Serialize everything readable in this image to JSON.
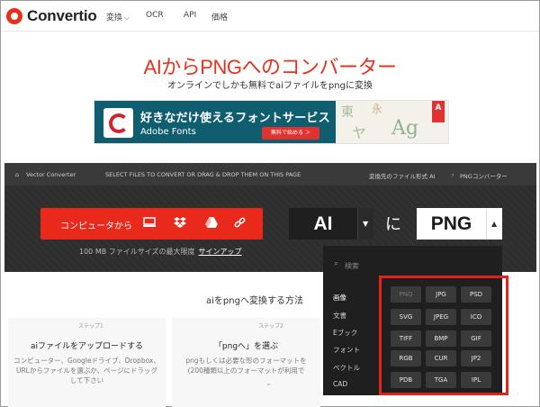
{
  "brand": {
    "name": "Convertio"
  },
  "nav": {
    "convert": "変換",
    "ocr": "OCR",
    "api": "API",
    "pricing": "価格"
  },
  "hero": {
    "title": "AIからPNGへのコンバーター",
    "subtitle": "オンラインでしかも無料でaiファイルをpngに変換"
  },
  "ad": {
    "headline": "好きなだけ使えるフォントサービス",
    "brand": "Adobe Fonts",
    "cta": "無料で始める ＞",
    "adobe_badge": "A"
  },
  "converter": {
    "breadcrumb": "Vector Converter",
    "instruction": "SELECT FILES TO CONVERT OR DRAG & DROP THEM ON THIS PAGE",
    "target_label": "変換先のファイル形式 AI",
    "target_link": "PNGコンバーター",
    "upload_label": "コンピュータから",
    "max_size": "100 MB ファイルサイズの最大限度",
    "signup": "サインアップ",
    "from_format": "AI",
    "connector": "に",
    "to_format": "PNG"
  },
  "dropdown": {
    "search_placeholder": "検索",
    "categories": [
      "画像",
      "文書",
      "Eブック",
      "フォント",
      "ベクトル",
      "CAD"
    ],
    "formats": [
      "PNG",
      "JPG",
      "PSD",
      "SVG",
      "JPEG",
      "ICO",
      "TIFF",
      "BMP",
      "GIF",
      "RGB",
      "CUR",
      "JP2",
      "PDB",
      "TGA",
      "IPL"
    ]
  },
  "howto": {
    "title": "aiをpngへ変換する方法",
    "step1_badge": "ステップ1",
    "step1_title": "aiファイルをアップロードする",
    "step1_desc": [
      "コンピューター、Googleドライブ、Dropbox、",
      "URLからファイルを選ぶか、ページにドラッグ",
      "して下さい"
    ],
    "step2_badge": "ステップ2",
    "step2_title": "「pngへ」を選ぶ",
    "step2_desc": [
      "pngもしくは必要な形のフォーマットを",
      "(200種類以上のフォーマットが利用で"
    ]
  },
  "colors": {
    "accent": "#e8311d",
    "highlight_frame": "#e2231a"
  }
}
